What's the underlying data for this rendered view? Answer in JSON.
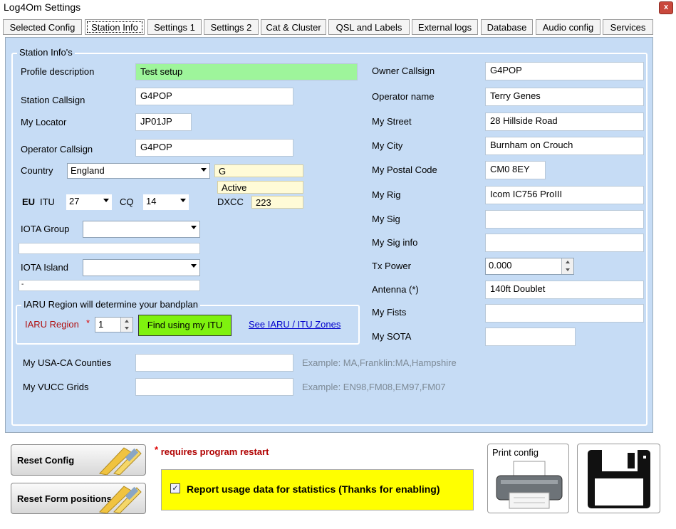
{
  "window": {
    "title": "Log4Om Settings",
    "close_glyph": "x"
  },
  "tabs": [
    {
      "label": "Selected Config"
    },
    {
      "label": "Station Info"
    },
    {
      "label": "Settings 1"
    },
    {
      "label": "Settings 2"
    },
    {
      "label": "Cat & Cluster"
    },
    {
      "label": "QSL and Labels"
    },
    {
      "label": "External logs"
    },
    {
      "label": "Database"
    },
    {
      "label": "Audio config"
    },
    {
      "label": "Services"
    }
  ],
  "group_title": "Station Info's",
  "left": {
    "profile_label": "Profile description",
    "profile_value": "Test setup",
    "callsign_label": "Station Callsign",
    "callsign_value": "G4POP",
    "locator_label": "My Locator",
    "locator_value": "JP01JP",
    "opcall_label": "Operator Callsign",
    "opcall_value": "G4POP",
    "country_label": "Country",
    "country_value": "England",
    "prefix_value": "G",
    "status_value": "Active",
    "eu_label": "EU",
    "itu_label": "ITU",
    "itu_value": "27",
    "cq_label": "CQ",
    "cq_value": "14",
    "dxcc_label": "DXCC",
    "dxcc_value": "223",
    "iota_group_label": "IOTA Group",
    "iota_island_label": "IOTA Island",
    "iota_island_sub": "-"
  },
  "iaru": {
    "legend": "IARU Region will determine your bandplan",
    "label": "IARU Region",
    "required_mark": "*",
    "value": "1",
    "find_button": "Find using my ITU",
    "link": "See IARU / ITU Zones"
  },
  "bottom_fields": {
    "counties_label": "My USA-CA Counties",
    "counties_example": "Example: MA,Franklin:MA,Hampshire",
    "vucc_label": "My VUCC Grids",
    "vucc_example": "Example: EN98,FM08,EM97,FM07"
  },
  "right": [
    {
      "label": "Owner Callsign",
      "value": "G4POP"
    },
    {
      "label": "Operator name",
      "value": "Terry Genes"
    },
    {
      "label": "My Street",
      "value": "28 Hillside Road"
    },
    {
      "label": "My City",
      "value": "Burnham on Crouch"
    },
    {
      "label": "My Postal Code",
      "value": "CM0 8EY"
    },
    {
      "label": "My Rig",
      "value": "Icom IC756 ProIII"
    },
    {
      "label": "My Sig",
      "value": ""
    },
    {
      "label": "My Sig info",
      "value": ""
    },
    {
      "label": "Tx Power",
      "value": "0.000"
    },
    {
      "label": "Antenna (*)",
      "value": "140ft Doublet"
    },
    {
      "label": "My Fists",
      "value": ""
    },
    {
      "label": "My SOTA",
      "value": ""
    }
  ],
  "footer": {
    "reset_config": "Reset Config",
    "reset_form": "Reset Form positions",
    "restart_mark": "*",
    "restart_note": "requires program restart",
    "usage_check": "✓",
    "usage_label": "Report usage data for statistics (Thanks for enabling)",
    "print_label": "Print config"
  }
}
